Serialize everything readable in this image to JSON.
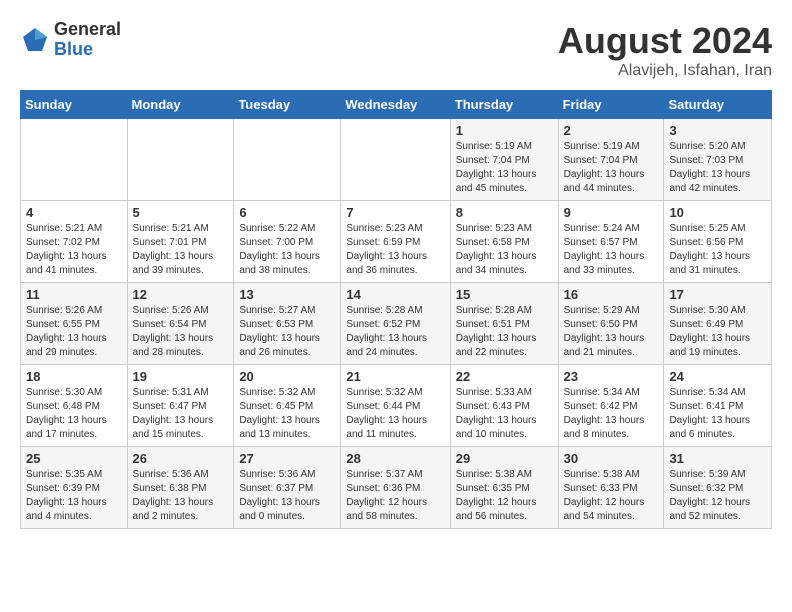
{
  "logo": {
    "general": "General",
    "blue": "Blue"
  },
  "title": {
    "month_year": "August 2024",
    "location": "Alavijeh, Isfahan, Iran"
  },
  "days_header": [
    "Sunday",
    "Monday",
    "Tuesday",
    "Wednesday",
    "Thursday",
    "Friday",
    "Saturday"
  ],
  "weeks": [
    [
      {
        "day": "",
        "info": ""
      },
      {
        "day": "",
        "info": ""
      },
      {
        "day": "",
        "info": ""
      },
      {
        "day": "",
        "info": ""
      },
      {
        "day": "1",
        "info": "Sunrise: 5:19 AM\nSunset: 7:04 PM\nDaylight: 13 hours\nand 45 minutes."
      },
      {
        "day": "2",
        "info": "Sunrise: 5:19 AM\nSunset: 7:04 PM\nDaylight: 13 hours\nand 44 minutes."
      },
      {
        "day": "3",
        "info": "Sunrise: 5:20 AM\nSunset: 7:03 PM\nDaylight: 13 hours\nand 42 minutes."
      }
    ],
    [
      {
        "day": "4",
        "info": "Sunrise: 5:21 AM\nSunset: 7:02 PM\nDaylight: 13 hours\nand 41 minutes."
      },
      {
        "day": "5",
        "info": "Sunrise: 5:21 AM\nSunset: 7:01 PM\nDaylight: 13 hours\nand 39 minutes."
      },
      {
        "day": "6",
        "info": "Sunrise: 5:22 AM\nSunset: 7:00 PM\nDaylight: 13 hours\nand 38 minutes."
      },
      {
        "day": "7",
        "info": "Sunrise: 5:23 AM\nSunset: 6:59 PM\nDaylight: 13 hours\nand 36 minutes."
      },
      {
        "day": "8",
        "info": "Sunrise: 5:23 AM\nSunset: 6:58 PM\nDaylight: 13 hours\nand 34 minutes."
      },
      {
        "day": "9",
        "info": "Sunrise: 5:24 AM\nSunset: 6:57 PM\nDaylight: 13 hours\nand 33 minutes."
      },
      {
        "day": "10",
        "info": "Sunrise: 5:25 AM\nSunset: 6:56 PM\nDaylight: 13 hours\nand 31 minutes."
      }
    ],
    [
      {
        "day": "11",
        "info": "Sunrise: 5:26 AM\nSunset: 6:55 PM\nDaylight: 13 hours\nand 29 minutes."
      },
      {
        "day": "12",
        "info": "Sunrise: 5:26 AM\nSunset: 6:54 PM\nDaylight: 13 hours\nand 28 minutes."
      },
      {
        "day": "13",
        "info": "Sunrise: 5:27 AM\nSunset: 6:53 PM\nDaylight: 13 hours\nand 26 minutes."
      },
      {
        "day": "14",
        "info": "Sunrise: 5:28 AM\nSunset: 6:52 PM\nDaylight: 13 hours\nand 24 minutes."
      },
      {
        "day": "15",
        "info": "Sunrise: 5:28 AM\nSunset: 6:51 PM\nDaylight: 13 hours\nand 22 minutes."
      },
      {
        "day": "16",
        "info": "Sunrise: 5:29 AM\nSunset: 6:50 PM\nDaylight: 13 hours\nand 21 minutes."
      },
      {
        "day": "17",
        "info": "Sunrise: 5:30 AM\nSunset: 6:49 PM\nDaylight: 13 hours\nand 19 minutes."
      }
    ],
    [
      {
        "day": "18",
        "info": "Sunrise: 5:30 AM\nSunset: 6:48 PM\nDaylight: 13 hours\nand 17 minutes."
      },
      {
        "day": "19",
        "info": "Sunrise: 5:31 AM\nSunset: 6:47 PM\nDaylight: 13 hours\nand 15 minutes."
      },
      {
        "day": "20",
        "info": "Sunrise: 5:32 AM\nSunset: 6:45 PM\nDaylight: 13 hours\nand 13 minutes."
      },
      {
        "day": "21",
        "info": "Sunrise: 5:32 AM\nSunset: 6:44 PM\nDaylight: 13 hours\nand 11 minutes."
      },
      {
        "day": "22",
        "info": "Sunrise: 5:33 AM\nSunset: 6:43 PM\nDaylight: 13 hours\nand 10 minutes."
      },
      {
        "day": "23",
        "info": "Sunrise: 5:34 AM\nSunset: 6:42 PM\nDaylight: 13 hours\nand 8 minutes."
      },
      {
        "day": "24",
        "info": "Sunrise: 5:34 AM\nSunset: 6:41 PM\nDaylight: 13 hours\nand 6 minutes."
      }
    ],
    [
      {
        "day": "25",
        "info": "Sunrise: 5:35 AM\nSunset: 6:39 PM\nDaylight: 13 hours\nand 4 minutes."
      },
      {
        "day": "26",
        "info": "Sunrise: 5:36 AM\nSunset: 6:38 PM\nDaylight: 13 hours\nand 2 minutes."
      },
      {
        "day": "27",
        "info": "Sunrise: 5:36 AM\nSunset: 6:37 PM\nDaylight: 13 hours\nand 0 minutes."
      },
      {
        "day": "28",
        "info": "Sunrise: 5:37 AM\nSunset: 6:36 PM\nDaylight: 12 hours\nand 58 minutes."
      },
      {
        "day": "29",
        "info": "Sunrise: 5:38 AM\nSunset: 6:35 PM\nDaylight: 12 hours\nand 56 minutes."
      },
      {
        "day": "30",
        "info": "Sunrise: 5:38 AM\nSunset: 6:33 PM\nDaylight: 12 hours\nand 54 minutes."
      },
      {
        "day": "31",
        "info": "Sunrise: 5:39 AM\nSunset: 6:32 PM\nDaylight: 12 hours\nand 52 minutes."
      }
    ]
  ]
}
